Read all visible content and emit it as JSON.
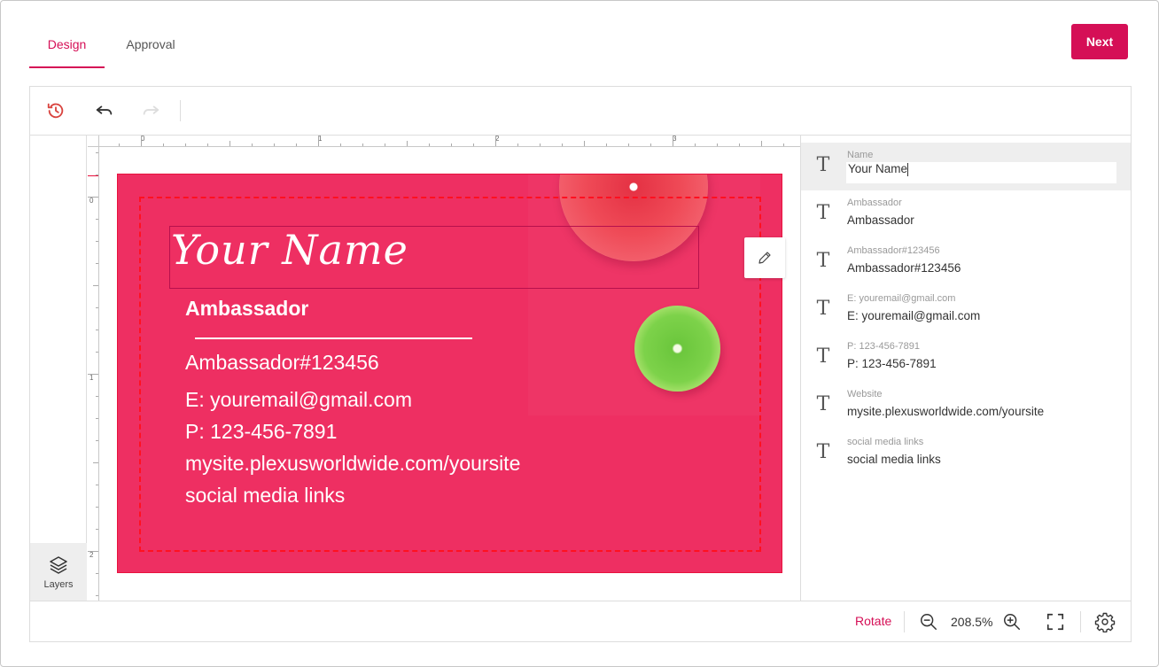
{
  "tabs": [
    {
      "label": "Design",
      "active": true
    },
    {
      "label": "Approval",
      "active": false
    }
  ],
  "header": {
    "next_label": "Next"
  },
  "colors": {
    "accent": "#d50f56",
    "card_background": "#ee2f62",
    "safe_zone": "#ff1020"
  },
  "toolbar": {
    "history_icon": "history-icon",
    "undo_icon": "undo-icon",
    "redo_icon": "redo-icon",
    "redo_enabled": false
  },
  "left_strip": {
    "layers_label": "Layers"
  },
  "rulers": {
    "top_labels": [
      "0",
      "1",
      "2",
      "3"
    ],
    "left_labels": [
      "0",
      "1",
      "2"
    ]
  },
  "card": {
    "name": "Your Name",
    "title": "Ambassador",
    "ambassador_id": "Ambassador#123456",
    "email": "E: youremail@gmail.com",
    "phone": "P: 123-456-7891",
    "website": "mysite.plexusworldwide.com/yoursite",
    "social": "social media links"
  },
  "fields": [
    {
      "label": "Name",
      "value": "Your Name",
      "active": true
    },
    {
      "label": "Ambassador",
      "value": "Ambassador"
    },
    {
      "label": "Ambassador#123456",
      "value": "Ambassador#123456"
    },
    {
      "label": "E: youremail@gmail.com",
      "value": "E: youremail@gmail.com"
    },
    {
      "label": "P: 123-456-7891",
      "value": "P: 123-456-7891"
    },
    {
      "label": "Website",
      "value": "mysite.plexusworldwide.com/yoursite"
    },
    {
      "label": "social media links",
      "value": "social media links"
    }
  ],
  "bottom_bar": {
    "rotate_label": "Rotate",
    "zoom_level": "208.5%"
  }
}
